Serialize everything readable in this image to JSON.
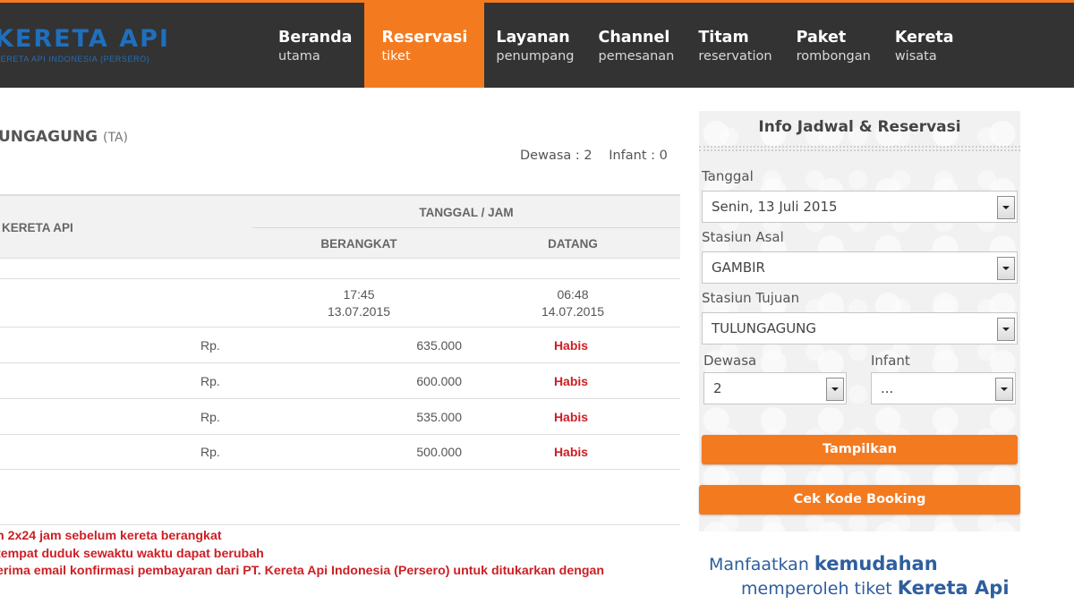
{
  "brand": {
    "title": "KERETA API",
    "subtitle": "KERETA API INDONESIA (PERSERO)"
  },
  "nav": [
    {
      "main": "Beranda",
      "sub": "utama",
      "active": false
    },
    {
      "main": "Reservasi",
      "sub": "tiket",
      "active": true
    },
    {
      "main": "Layanan",
      "sub": "penumpang",
      "active": false
    },
    {
      "main": "Channel",
      "sub": "pemesanan",
      "active": false
    },
    {
      "main": "Titam",
      "sub": "reservation",
      "active": false
    },
    {
      "main": "Paket",
      "sub": "rombongan",
      "active": false
    },
    {
      "main": "Kereta",
      "sub": "wisata",
      "active": false
    }
  ],
  "route": {
    "station": "UNGAGUNG",
    "code": "(TA)"
  },
  "passengers": {
    "adult": "Dewasa : 2",
    "infant": "Infant : 0"
  },
  "table": {
    "col_train": "KERETA API",
    "col_datetime": "TANGGAL / JAM",
    "col_depart": "BERANGKAT",
    "col_arrive": "DATANG",
    "depart_time": "17:45",
    "depart_date": "13.07.2015",
    "arrive_time": "06:48",
    "arrive_date": "14.07.2015",
    "fares": [
      {
        "currency": "Rp.",
        "price": "635.000",
        "status": "Habis"
      },
      {
        "currency": "Rp.",
        "price": "600.000",
        "status": "Habis"
      },
      {
        "currency": "Rp.",
        "price": "535.000",
        "status": "Habis"
      },
      {
        "currency": "Rp.",
        "price": "500.000",
        "status": "Habis"
      }
    ]
  },
  "notes": [
    "n 2x24 jam sebelum kereta berangkat",
    "tempat duduk sewaktu waktu dapat berubah",
    "erima email konfirmasi pembayaran dari PT. Kereta Api Indonesia (Persero) untuk ditukarkan dengan"
  ],
  "sidebar": {
    "title": "Info Jadwal & Reservasi",
    "date_label": "Tanggal",
    "date_value": "Senin, 13 Juli 2015",
    "origin_label": "Stasiun Asal",
    "origin_value": "GAMBIR",
    "destination_label": "Stasiun Tujuan",
    "destination_value": "TULUNGAGUNG",
    "adult_label": "Dewasa",
    "adult_value": "2",
    "infant_label": "Infant",
    "infant_value": "...",
    "show_button": "Tampilkan",
    "booking_button": "Cek Kode Booking"
  },
  "promo": {
    "line1_normal": "Manfaatkan ",
    "line1_bold": "kemudahan",
    "line2_normal": "memperoleh tiket ",
    "line2_bold": "Kereta Api"
  },
  "colors": {
    "accent": "#f47a20",
    "header_bg": "#333333",
    "brand_blue": "#1f6fbf",
    "status_red": "#cc1f24"
  }
}
